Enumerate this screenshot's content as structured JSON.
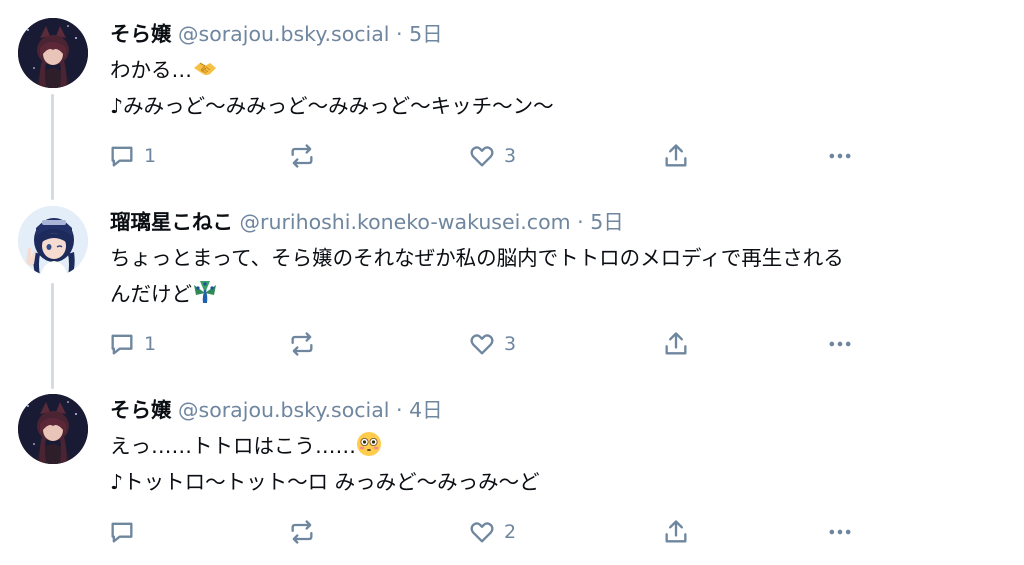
{
  "posts": [
    {
      "author": "そら嬢",
      "handle": "@sorajou.bsky.social",
      "separator": "·",
      "time": "5日",
      "lines": [
        "わかる…",
        "♪みみっど〜みみっど〜みみっど〜キッチ〜ン〜"
      ],
      "emoji": "handshake",
      "reply_count": "1",
      "like_count": "3"
    },
    {
      "author": "瑠璃星こねこ",
      "handle": "@rurihoshi.koneko-wakusei.com",
      "separator": "·",
      "time": "5日",
      "lines": [
        "ちょっとまって、そら嬢のそれなぜか私の脳内でトトロのメロディで再生される",
        "んだけど"
      ],
      "emoji": "peacock",
      "reply_count": "1",
      "like_count": "3"
    },
    {
      "author": "そら嬢",
      "handle": "@sorajou.bsky.social",
      "separator": "·",
      "time": "4日",
      "lines": [
        "えっ……トトロはこう……",
        "♪トットロ〜トット〜ロ みっみど〜みっみ〜ど"
      ],
      "emoji": "flushed",
      "reply_count": "",
      "like_count": "2"
    }
  ],
  "colors": {
    "muted": "#6f869f",
    "thread_line": "#d4dbe2",
    "text": "#0b0f14"
  },
  "icons": [
    "reply-icon",
    "repost-icon",
    "like-icon",
    "share-icon",
    "more-icon"
  ]
}
